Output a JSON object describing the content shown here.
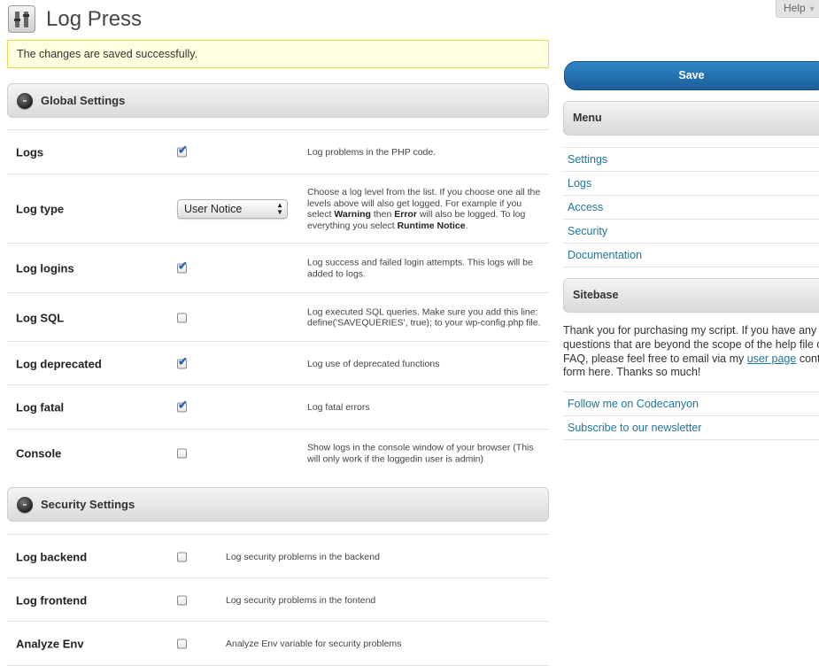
{
  "header": {
    "title": "Log Press",
    "help_label": "Help"
  },
  "notice": {
    "text": "The changes are saved successfully."
  },
  "global_settings": {
    "title": "Global Settings",
    "rows": [
      {
        "label": "Logs",
        "checked": true,
        "desc": "Log problems in the PHP code."
      },
      {
        "label": "Log type",
        "select_value": "User Notice",
        "desc": {
          "line1": "Choose a log level from the list. If you choose one all the",
          "line2": "levels above will also get logged. For example if you",
          "line3_pre": "select ",
          "line3_b1": "Warning",
          "line3_mid": " then ",
          "line3_b2": "Error",
          "line3_post": " will also be logged. To log",
          "line4_pre": "everything you select ",
          "line4_b": "Runtime Notice",
          "line4_post": "."
        }
      },
      {
        "label": "Log logins",
        "checked": true,
        "desc_line1": "Log success and failed login attempts. This logs will be",
        "desc_line2": "added to logs."
      },
      {
        "label": "Log SQL",
        "checked": false,
        "desc_line1": "Log executed SQL queries. Make sure you add this line:",
        "desc_line2": "define('SAVEQUERIES', true); to your wp-config.php file."
      },
      {
        "label": "Log deprecated",
        "checked": true,
        "desc": "Log use of deprecated functions"
      },
      {
        "label": "Log fatal",
        "checked": true,
        "desc": "Log fatal errors"
      },
      {
        "label": "Console",
        "checked": false,
        "desc_line1": "Show logs in the console window of your browser (This",
        "desc_line2": "will only work if the loggedin user is admin)"
      }
    ]
  },
  "security_settings": {
    "title": "Security Settings",
    "rows": [
      {
        "label": "Log backend",
        "checked": false,
        "desc": "Log security problems in the backend"
      },
      {
        "label": "Log frontend",
        "checked": false,
        "desc": "Log security problems in the fontend"
      },
      {
        "label": "Analyze Env",
        "checked": false,
        "desc": "Analyze Env variable for security problems"
      }
    ]
  },
  "sidebar": {
    "save_label": "Save",
    "menu_title": "Menu",
    "menu_items": [
      "Settings",
      "Logs",
      "Access",
      "Security",
      "Documentation"
    ],
    "sitebase_title": "Sitebase",
    "sitebase_text": {
      "line1": "Thank you for purchasing my script. If you have any",
      "line2": "questions that are beyond the scope of the help file or",
      "line3_pre": "FAQ, please feel free to email via my ",
      "line3_link": "user page",
      "line3_post": " contact",
      "line4": "form here. Thanks so much!"
    },
    "links": [
      "Follow me on Codecanyon",
      "Subscribe to our newsletter"
    ]
  },
  "colors": {
    "link": "#21759b",
    "save_button": "#2166a8",
    "notice_bg": "#ffffe0"
  }
}
